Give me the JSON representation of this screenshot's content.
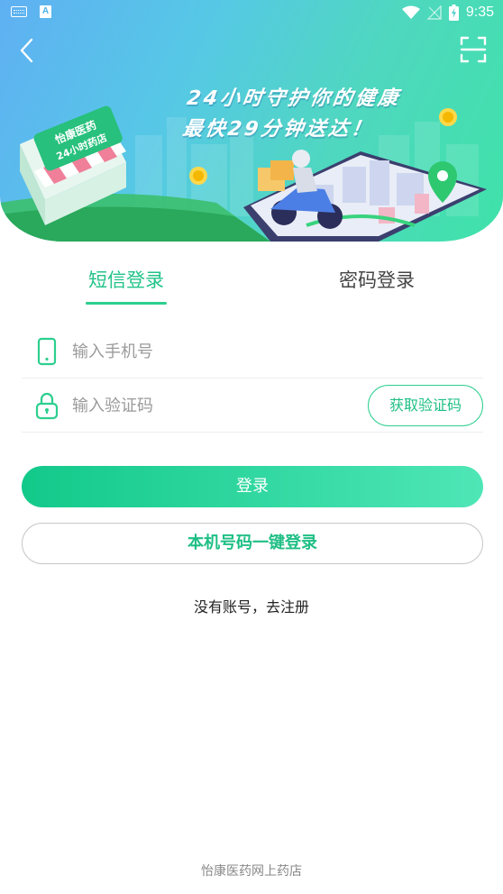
{
  "status_bar": {
    "time": "9:35"
  },
  "hero": {
    "store_sign_line1": "怡康医药",
    "store_sign_line2": "24小时药店",
    "slogan_line1": "24小时守护你的健康",
    "slogan_line2": "最快29分钟送达！"
  },
  "tabs": [
    {
      "label": "短信登录",
      "active": true
    },
    {
      "label": "密码登录",
      "active": false
    }
  ],
  "form": {
    "phone_placeholder": "输入手机号",
    "phone_value": "",
    "code_placeholder": "输入验证码",
    "code_value": "",
    "get_code_label": "获取验证码"
  },
  "buttons": {
    "login_label": "登录",
    "one_key_login_label": "本机号码一键登录"
  },
  "register_link": "没有账号，去注册",
  "footer": "怡康医药网上药店",
  "colors": {
    "accent": "#2ccf8f",
    "accent_text": "#1fbf85",
    "hero_left": "#5fb0f2",
    "hero_right": "#3fe2a8"
  }
}
